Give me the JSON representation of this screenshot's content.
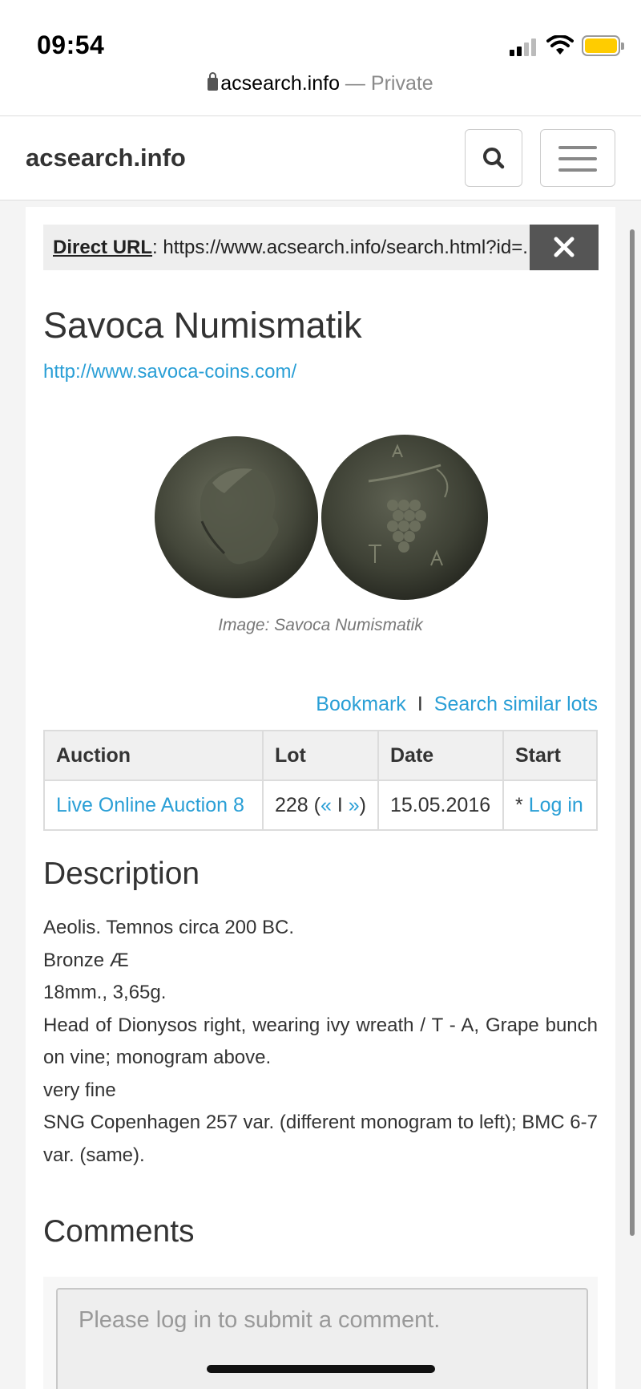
{
  "status_bar": {
    "time": "09:54"
  },
  "browser": {
    "domain": "acsearch.info",
    "separator": " — ",
    "mode": "Private"
  },
  "navbar": {
    "brand": "acsearch.info"
  },
  "direct_url": {
    "label": "Direct URL",
    "value": ": https://www.acsearch.info/search.html?id=..."
  },
  "dealer": {
    "name": "Savoca Numismatik",
    "link": "http://www.savoca-coins.com/"
  },
  "image": {
    "caption": "Image: Savoca Numismatik"
  },
  "actions": {
    "bookmark": "Bookmark",
    "separator": "I",
    "search_similar": "Search similar lots"
  },
  "lot_table": {
    "headers": {
      "auction": "Auction",
      "lot": "Lot",
      "date": "Date",
      "start": "Start"
    },
    "row": {
      "auction": "Live Online Auction 8",
      "lot_number": "228",
      "lot_open": " (",
      "prev": "«",
      "pipe": " I ",
      "next": "»",
      "lot_close": ")",
      "date": "15.05.2016",
      "start_prefix": "* ",
      "start_link": "Log in"
    }
  },
  "description": {
    "heading": "Description",
    "lines": [
      "Aeolis. Temnos circa 200 BC.",
      "Bronze Æ",
      "18mm., 3,65g.",
      "Head of Dionysos right, wearing ivy wreath / T - A, Grape bunch on vine; monogram above.",
      "very fine",
      "SNG Copenhagen 257 var. (different monogram to left); BMC 6-7 var. (same)."
    ]
  },
  "comments": {
    "heading": "Comments",
    "placeholder": "Please log in to submit a comment."
  },
  "colors": {
    "link": "#2a9fd6",
    "battery": "#ffcc00",
    "close_bg": "#555555"
  }
}
